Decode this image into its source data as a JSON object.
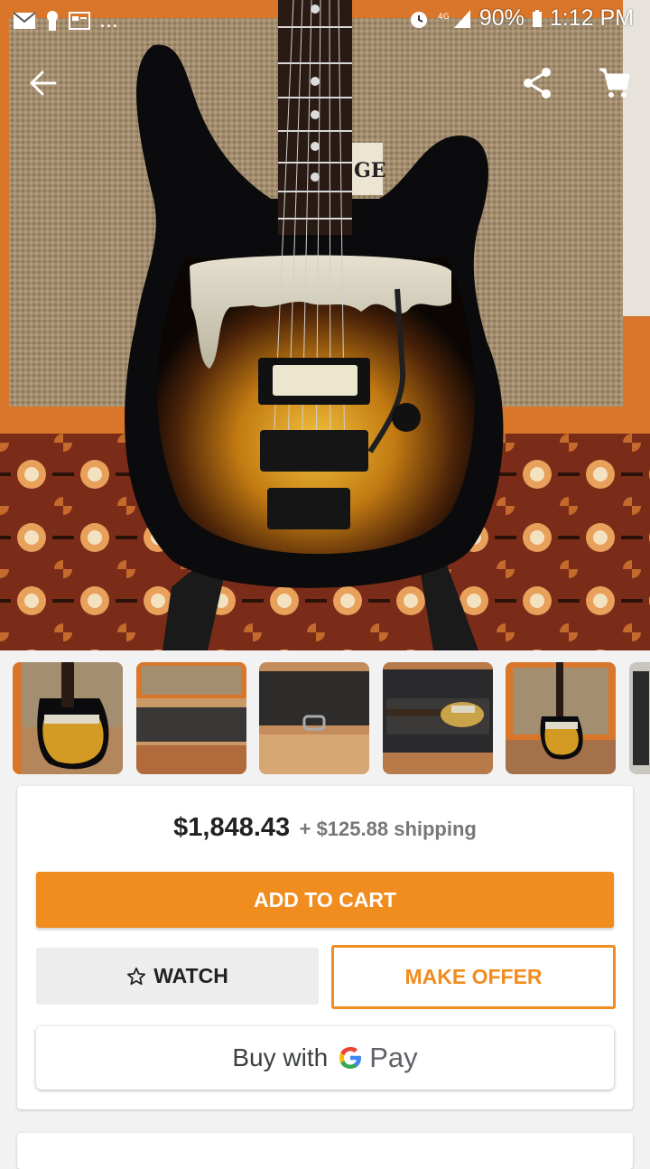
{
  "status_bar": {
    "battery": "90%",
    "time": "1:12 PM",
    "overflow": "..."
  },
  "toolbar": {
    "back_icon": "arrow-left-icon",
    "share_icon": "share-icon",
    "cart_icon": "shopping-cart-icon"
  },
  "gallery": {
    "thumbnails": [
      "guitar-front",
      "amp-top",
      "guitar-case-closed",
      "guitar-in-case",
      "guitar-with-amp",
      "partial"
    ]
  },
  "purchase": {
    "price": "$1,848.43",
    "shipping": "+ $125.88 shipping",
    "add_to_cart_label": "ADD TO CART",
    "watch_label": "WATCH",
    "make_offer_label": "MAKE OFFER",
    "buy_with_label": "Buy with",
    "gpay_g": "G",
    "gpay_pay": "Pay"
  },
  "colors": {
    "accent": "#f18c1f",
    "watch_bg": "#ededed"
  }
}
